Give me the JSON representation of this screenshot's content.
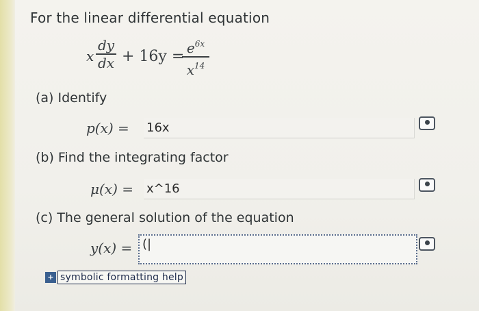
{
  "title": "For the linear differential equation",
  "equation": {
    "lhs_coef": "x",
    "dy": "dy",
    "dx": "dx",
    "plus_term": "+ 16y =",
    "rhs_num": "e",
    "rhs_num_exp": "6x",
    "rhs_den": "x",
    "rhs_den_exp": "14"
  },
  "parts": {
    "a": {
      "label": "(a) Identify",
      "math_label": "p(x) =",
      "value": "16x"
    },
    "b": {
      "label": "(b) Find the integrating factor",
      "math_label": "μ(x) =",
      "value": "x^16"
    },
    "c": {
      "label": "(c) The general solution of the equation",
      "math_label": "y(x) =",
      "value": "(|"
    }
  },
  "help": {
    "badge": "+",
    "text": "symbolic formatting help"
  },
  "icons": {
    "preview": "eye-preview-icon"
  }
}
